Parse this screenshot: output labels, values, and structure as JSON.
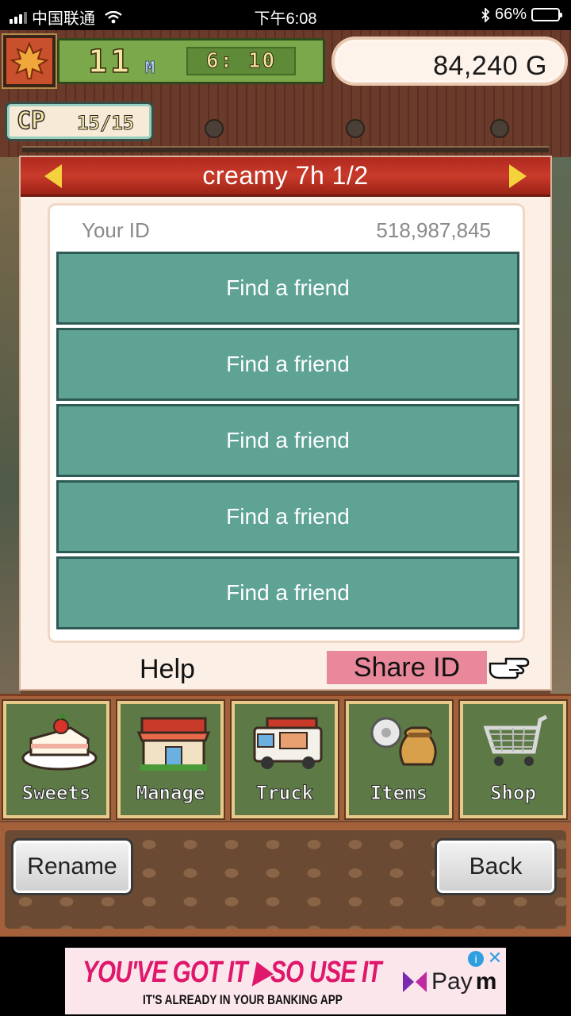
{
  "status_bar": {
    "carrier": "中国联通",
    "time": "下午6:08",
    "battery": "66%",
    "battery_level": 0.66
  },
  "hud": {
    "month": "11",
    "month_unit": "M",
    "clock": "6: 10",
    "gold": "84,240 G",
    "cp_label": "CP",
    "cp_value": "15/15"
  },
  "dialog": {
    "title": "creamy  7h 1/2",
    "your_id_label": "Your ID",
    "your_id_value": "518,987,845",
    "friend_slots": [
      {
        "label": "Find a friend"
      },
      {
        "label": "Find a friend"
      },
      {
        "label": "Find a friend"
      },
      {
        "label": "Find a friend"
      },
      {
        "label": "Find a friend"
      }
    ],
    "help_label": "Help",
    "share_label": "Share ID"
  },
  "menu": {
    "items": [
      {
        "label": "Sweets",
        "icon": "cake-icon"
      },
      {
        "label": "Manage",
        "icon": "shop-building-icon"
      },
      {
        "label": "Truck",
        "icon": "food-truck-icon"
      },
      {
        "label": "Items",
        "icon": "items-bag-icon"
      },
      {
        "label": "Shop",
        "icon": "shopping-cart-icon"
      }
    ]
  },
  "actions": {
    "rename_label": "Rename",
    "back_label": "Back"
  },
  "ad": {
    "headline": "YOU'VE GOT IT ▶SO USE IT",
    "subline": "IT'S ALREADY IN YOUR BANKING APP",
    "brand": "Pay",
    "brand_suffix": "m",
    "info": "i",
    "close": "✕"
  },
  "colors": {
    "dialog_header": "#c93a2a",
    "friend_button": "#5fa395",
    "share_button": "#e8889a",
    "menu_tile": "#5d7a46",
    "ad_accent": "#e0186c"
  }
}
